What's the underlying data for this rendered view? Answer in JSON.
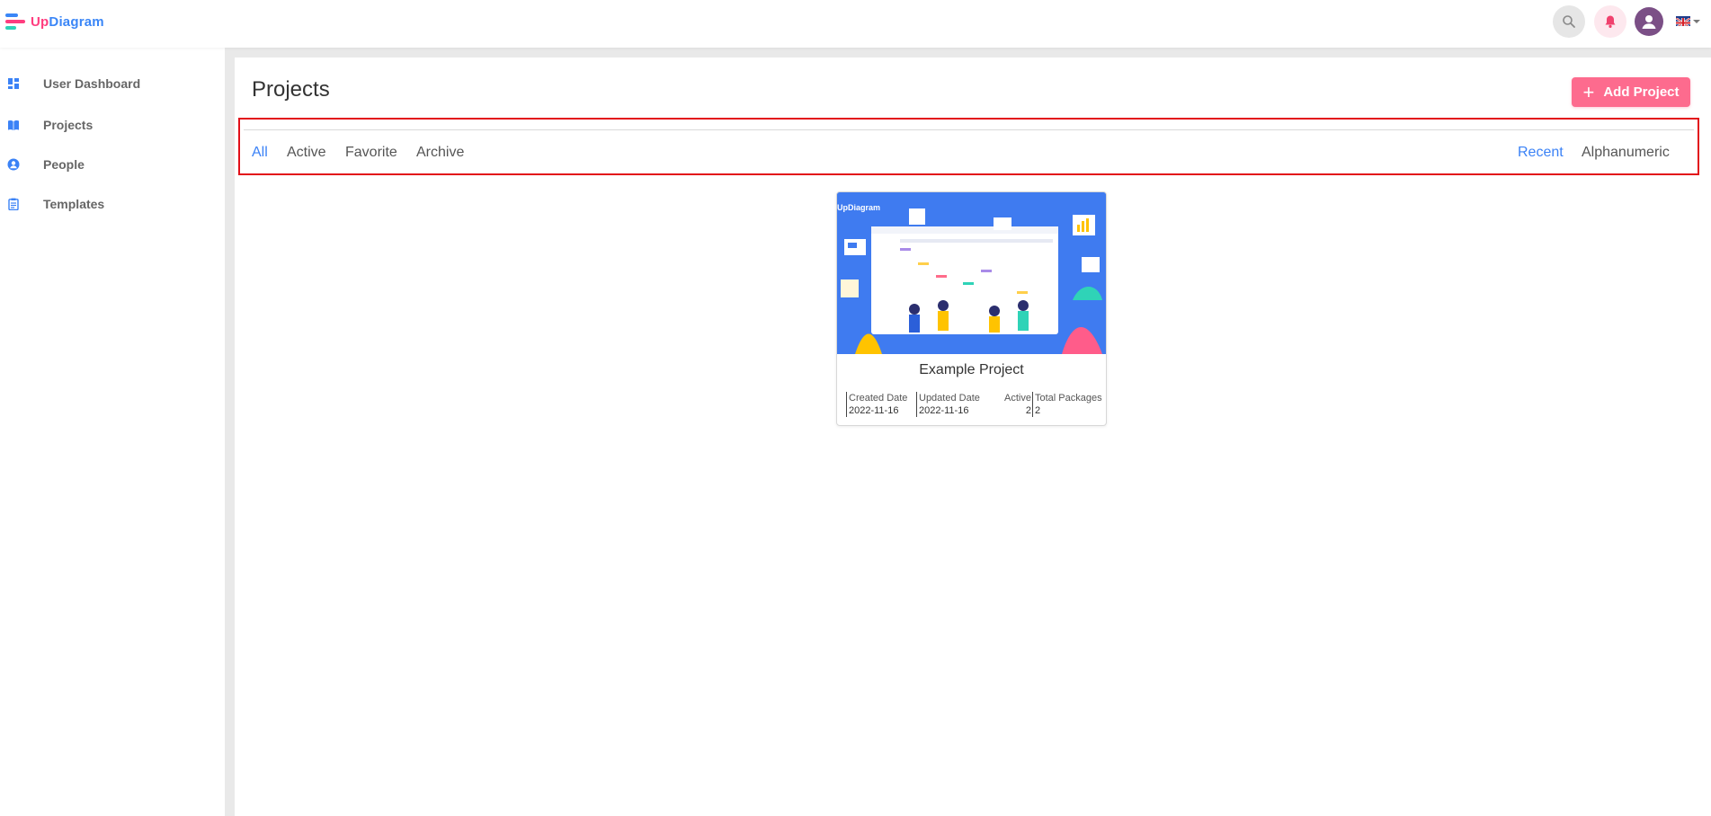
{
  "header": {
    "logo": {
      "part1": "Up",
      "part2": "Diagram"
    },
    "icons": {
      "search": "search-icon",
      "notifications": "bell-icon",
      "avatar": "user-avatar-icon",
      "language": "uk-flag-icon"
    }
  },
  "sidebar": {
    "items": [
      {
        "label": "User Dashboard",
        "icon": "dashboard-icon"
      },
      {
        "label": "Projects",
        "icon": "book-icon"
      },
      {
        "label": "People",
        "icon": "person-icon"
      },
      {
        "label": "Templates",
        "icon": "clipboard-icon"
      }
    ]
  },
  "main": {
    "title": "Projects",
    "add_button": "Add Project",
    "filters": {
      "tabs": [
        "All",
        "Active",
        "Favorite",
        "Archive"
      ],
      "active_tab": "All",
      "sort": [
        "Recent",
        "Alphanumeric"
      ],
      "active_sort": "Recent"
    },
    "projects": [
      {
        "name": "Example Project",
        "thumbnail_text": "UpDiagram",
        "created_label": "Created Date",
        "created_value": "2022-11-16",
        "updated_label": "Updated Date",
        "updated_value": "2022-11-16",
        "active_label": "Active",
        "active_value": "2",
        "packages_label": "Total Packages",
        "packages_value": "2"
      }
    ]
  },
  "colors": {
    "accent_blue": "#3b82f6",
    "accent_pink": "#fd6b8e",
    "highlight_red": "#e2101a",
    "background": "#e9e9e9"
  }
}
